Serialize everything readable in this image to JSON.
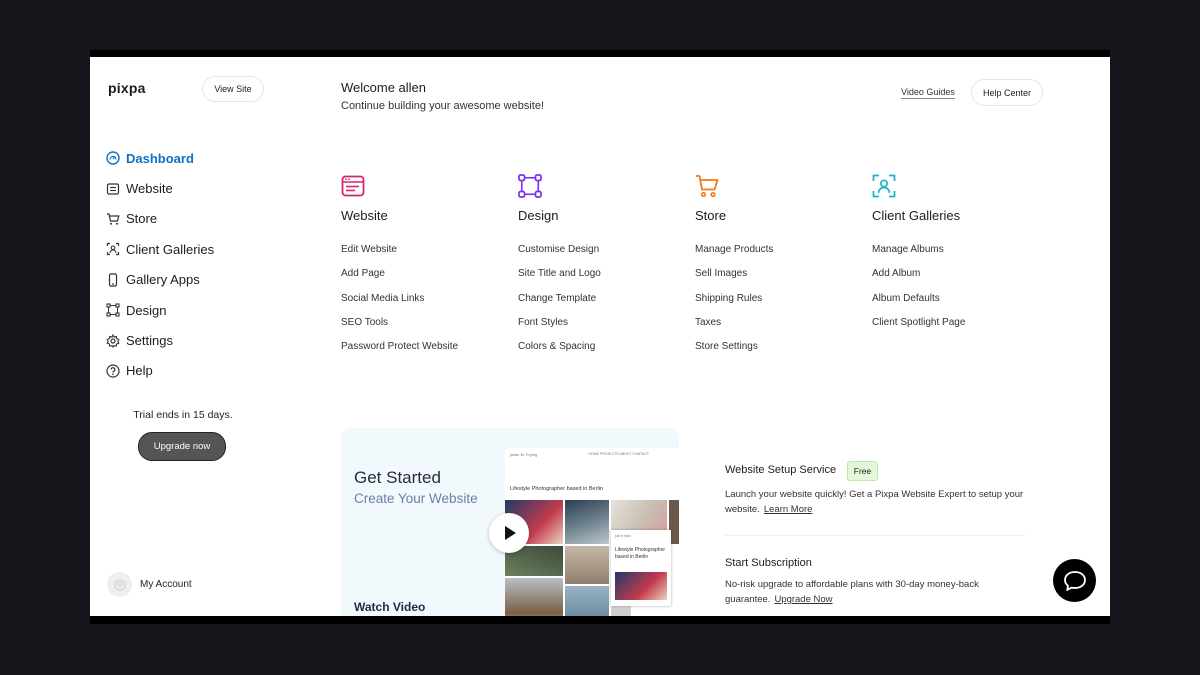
{
  "brand": {
    "logo": "pixpa",
    "view_site": "View Site"
  },
  "sidebar": {
    "items": [
      {
        "label": "Dashboard",
        "icon": "dashboard-icon",
        "active": true
      },
      {
        "label": "Website",
        "icon": "website-icon"
      },
      {
        "label": "Store",
        "icon": "cart-icon"
      },
      {
        "label": "Client Galleries",
        "icon": "client-galleries-icon"
      },
      {
        "label": "Gallery Apps",
        "icon": "mobile-icon"
      },
      {
        "label": "Design",
        "icon": "design-icon"
      },
      {
        "label": "Settings",
        "icon": "gear-icon"
      },
      {
        "label": "Help",
        "icon": "help-icon"
      }
    ],
    "trial_text": "Trial ends in 15 days.",
    "upgrade_label": "Upgrade now",
    "account_label": "My Account"
  },
  "header": {
    "welcome": "Welcome allen",
    "subtitle": "Continue building your awesome website!",
    "video_guides": "Video Guides",
    "help_center": "Help Center"
  },
  "columns": [
    {
      "title": "Website",
      "color": "#d6246e",
      "links": [
        "Edit Website",
        "Add Page",
        "Social Media Links",
        "SEO Tools",
        "Password Protect Website"
      ]
    },
    {
      "title": "Design",
      "color": "#7b2ff2",
      "links": [
        "Customise Design",
        "Site Title and Logo",
        "Change Template",
        "Font Styles",
        "Colors & Spacing"
      ]
    },
    {
      "title": "Store",
      "color": "#f07b1c",
      "links": [
        "Manage Products",
        "Sell Images",
        "Shipping Rules",
        "Taxes",
        "Store Settings"
      ]
    },
    {
      "title": "Client Galleries",
      "color": "#1bb5c9",
      "links": [
        "Manage Albums",
        "Add Album",
        "Album Defaults",
        "Client Spotlight Page"
      ]
    }
  ],
  "get_started": {
    "title": "Get Started",
    "subtitle": "Create Your Website",
    "watch": "Watch Video",
    "preview_name": "julian M. Frying",
    "preview_menu": "HOME  PROJECTS  ABOUT  CONTACT",
    "preview_title": "Lifestyle Photographer based in Berlin",
    "inner_label": "juli m rilan",
    "inner_text": "Lifestyle Photographer based in Berlin"
  },
  "setup_service": {
    "title": "Website Setup Service",
    "badge": "Free",
    "text": "Launch your website quickly! Get a Pixpa Website Expert to setup your website.",
    "link": "Learn More"
  },
  "subscription": {
    "title": "Start Subscription",
    "text": "No-risk upgrade to affordable plans with 30-day money-back guarantee.",
    "link": "Upgrade Now"
  }
}
